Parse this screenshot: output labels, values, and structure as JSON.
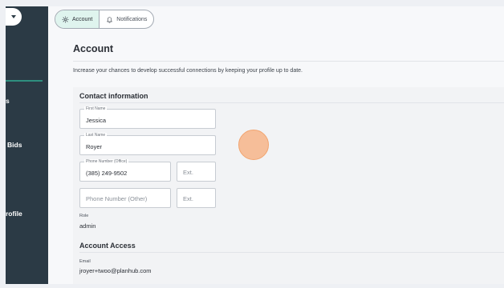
{
  "sidebar": {
    "items": [
      {
        "label": "s"
      },
      {
        "label": "Bids"
      },
      {
        "label": "rofile"
      }
    ]
  },
  "tabs": [
    {
      "label": "Account",
      "icon": "gear-icon",
      "active": true
    },
    {
      "label": "Notifications",
      "icon": "bell-icon",
      "active": false
    }
  ],
  "page": {
    "title": "Account",
    "subtitle": "Increase your chances to develop successful connections by keeping your profile up to date."
  },
  "contact": {
    "title": "Contact information",
    "first_name": {
      "label": "First Name",
      "value": "Jessica"
    },
    "last_name": {
      "label": "Last Name",
      "value": "Royer"
    },
    "phone_office": {
      "label": "Phone Number (Office)",
      "value": "(385) 249-9502"
    },
    "ext_office": {
      "placeholder": "Ext."
    },
    "phone_other": {
      "placeholder": "Phone Number (Other)"
    },
    "ext_other": {
      "placeholder": "Ext."
    },
    "role": {
      "label": "Role",
      "value": "admin"
    }
  },
  "access": {
    "title": "Account Access",
    "email": {
      "label": "Email",
      "value": "jroyer+twoo@planhub.com"
    }
  },
  "colors": {
    "sidebar": "#2b3a45",
    "accent": "#2f8f7f",
    "active_tab": "#dff4ee",
    "cursor": "#f6b082"
  }
}
